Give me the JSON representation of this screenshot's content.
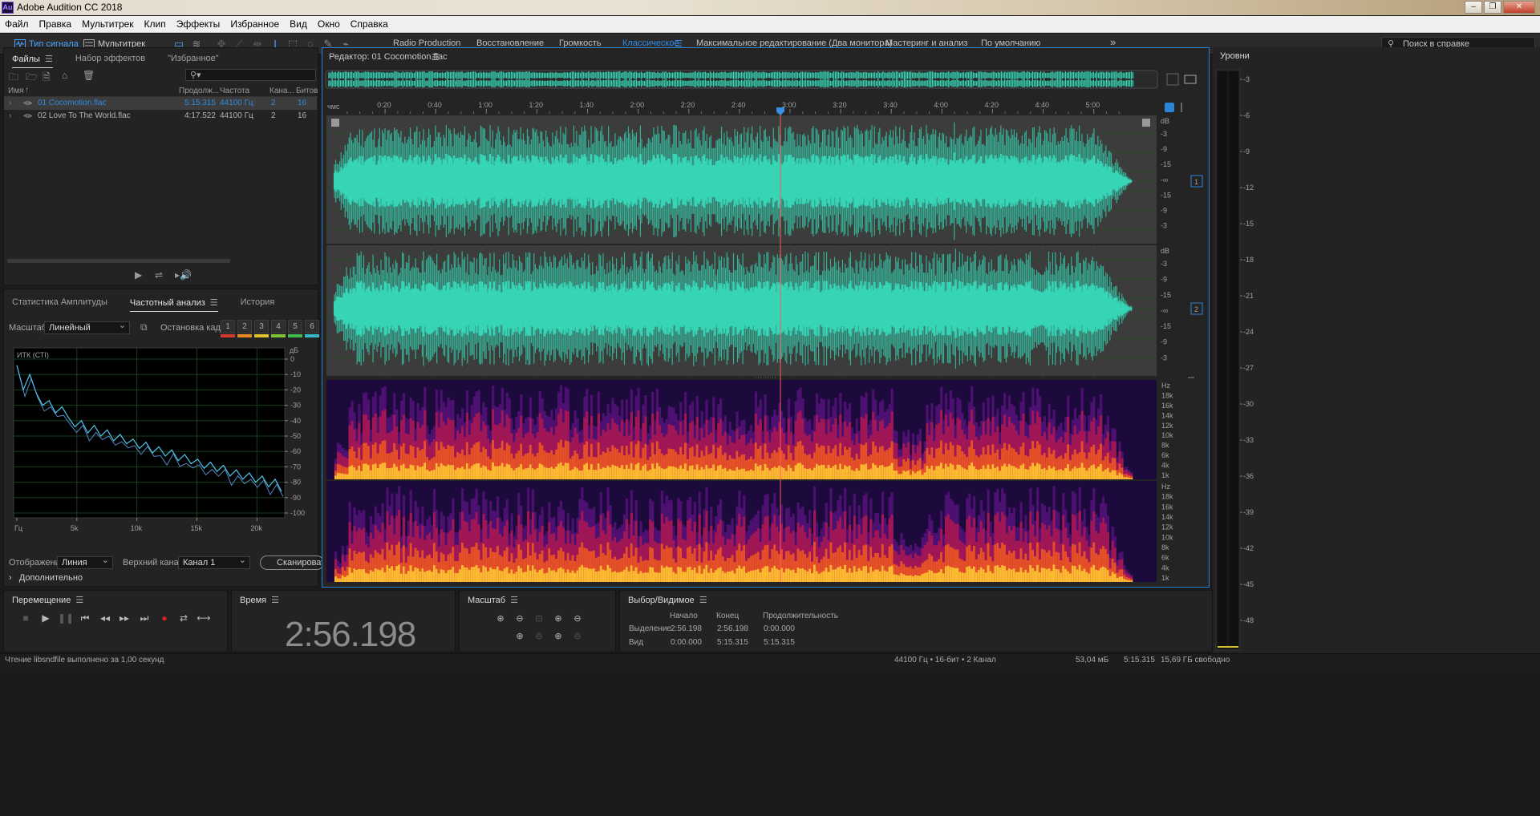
{
  "window": {
    "title": "Adobe Audition CC 2018",
    "app_icon": "Au"
  },
  "menu": [
    "Файл",
    "Правка",
    "Мультитрек",
    "Клип",
    "Эффекты",
    "Избранное",
    "Вид",
    "Окно",
    "Справка"
  ],
  "toolbar": {
    "waveform_mode": "Тип сигнала",
    "multitrack_mode": "Мультитрек",
    "workspaces": [
      "Radio Production",
      "Восстановление",
      "Громкость",
      "Классическое",
      "Максимальное редактирование (Два монитора)",
      "Мастеринг и анализ",
      "По умолчанию"
    ],
    "active_workspace": "Классическое",
    "help_placeholder": "Поиск в справке"
  },
  "files_panel": {
    "tabs": [
      "Файлы",
      "Набор эффектов",
      "\"Избранное\""
    ],
    "columns": [
      "Имя",
      "Продолж...",
      "Частота",
      "Кана...",
      "Битов"
    ],
    "files": [
      {
        "name": "01 Cocomotion.flac",
        "duration": "5:15.315",
        "rate": "44100 Гц",
        "channels": "2",
        "bits": "16"
      },
      {
        "name": "02 Love To The World.flac",
        "duration": "4:17.522",
        "rate": "44100 Гц",
        "channels": "2",
        "bits": "16"
      }
    ]
  },
  "analysis_panel": {
    "tabs": [
      "Статистика Амплитуды",
      "Частотный анализ",
      "История"
    ],
    "scale_label": "Масштаб:",
    "scale_value": "Линейный",
    "freeze_label": "Остановка кадра:",
    "freeze_buttons": [
      "1",
      "2",
      "3",
      "4",
      "5",
      "6"
    ],
    "freeze_colors": [
      "#d23a2e",
      "#e98b23",
      "#e3c32a",
      "#7fc234",
      "#3fbb4f",
      "#38b9c9"
    ],
    "plot_title": "ИТК (СТI)",
    "db_axis": [
      "дБ",
      "0",
      "-10",
      "-20",
      "-30",
      "-40",
      "-50",
      "-60",
      "-70",
      "-80",
      "-90",
      "-100"
    ],
    "freq_axis": [
      "Гц",
      "5k",
      "10k",
      "15k",
      "20k"
    ],
    "display_label": "Отображение:",
    "display_value": "Линия",
    "channel_label": "Верхний канал:",
    "channel_value": "Канал 1",
    "scan_button": "Сканировать",
    "advanced": "Дополнительно",
    "spectrum_db": [
      -4,
      -20,
      -10,
      -22,
      -30,
      -27,
      -35,
      -31,
      -38,
      -44,
      -40,
      -48,
      -43,
      -50,
      -46,
      -53,
      -49,
      -55,
      -52,
      -58,
      -54,
      -61,
      -57,
      -63,
      -59,
      -66,
      -62,
      -68,
      -65,
      -71,
      -67,
      -73,
      -69,
      -76,
      -72,
      -78,
      -74,
      -80,
      -76,
      -83,
      -78,
      -86
    ]
  },
  "editor": {
    "title": "Редактор: 01 Cocomotion.flac",
    "time_unit": "чмс",
    "time_labels": [
      "0:20",
      "0:40",
      "1:00",
      "1:20",
      "1:40",
      "2:00",
      "2:20",
      "2:40",
      "3:00",
      "3:20",
      "3:40",
      "4:00",
      "4:20",
      "4:40",
      "5:00"
    ],
    "db_labels": [
      "dB",
      "-3",
      "-9",
      "-15",
      "-∞",
      "-15",
      "-9",
      "-3"
    ],
    "channel_badges": [
      "1",
      "2"
    ],
    "hz_labels": [
      "Hz",
      "18k",
      "16k",
      "14k",
      "12k",
      "10k",
      "8k",
      "6k",
      "4k",
      "1k"
    ],
    "playhead_time": "2:56.198",
    "colors": {
      "waveform": "#36d5b5",
      "playhead": "#ff5a5a",
      "spectrum_bg": "#1d0a3c"
    }
  },
  "levels": {
    "title": "Уровни",
    "scale": [
      "-3",
      "-6",
      "-9",
      "-12",
      "-15",
      "-18",
      "-21",
      "-24",
      "-27",
      "-30",
      "-33",
      "-36",
      "-39",
      "-42",
      "-45",
      "-48"
    ]
  },
  "transport": {
    "title": "Перемещение",
    "buttons": [
      "stop-icon",
      "play-icon",
      "pause-icon",
      "go-to-start-icon",
      "rewind-icon",
      "fast-forward-icon",
      "go-to-end-icon",
      "record-icon",
      "loop-icon",
      "skip-icon"
    ]
  },
  "time_panel": {
    "title": "Время",
    "value": "2:56.198"
  },
  "zoom_panel": {
    "title": "Масштаб"
  },
  "selection_panel": {
    "title": "Выбор/Видимое",
    "cols": [
      "Начало",
      "Конец",
      "Продолжительность"
    ],
    "rows": [
      {
        "label": "Выделение",
        "start": "2:56.198",
        "end": "2:56.198",
        "duration": "0:00.000"
      },
      {
        "label": "Вид",
        "start": "0:00.000",
        "end": "5:15.315",
        "duration": "5:15.315"
      }
    ]
  },
  "status": {
    "message": "Чтение libsndfile выполнено за 1,00 секунд",
    "format": "44100 Гц • 16-бит • 2 Канал",
    "size": "53,04 мБ",
    "duration": "5:15.315",
    "free": "15,69 ГБ свободно"
  }
}
